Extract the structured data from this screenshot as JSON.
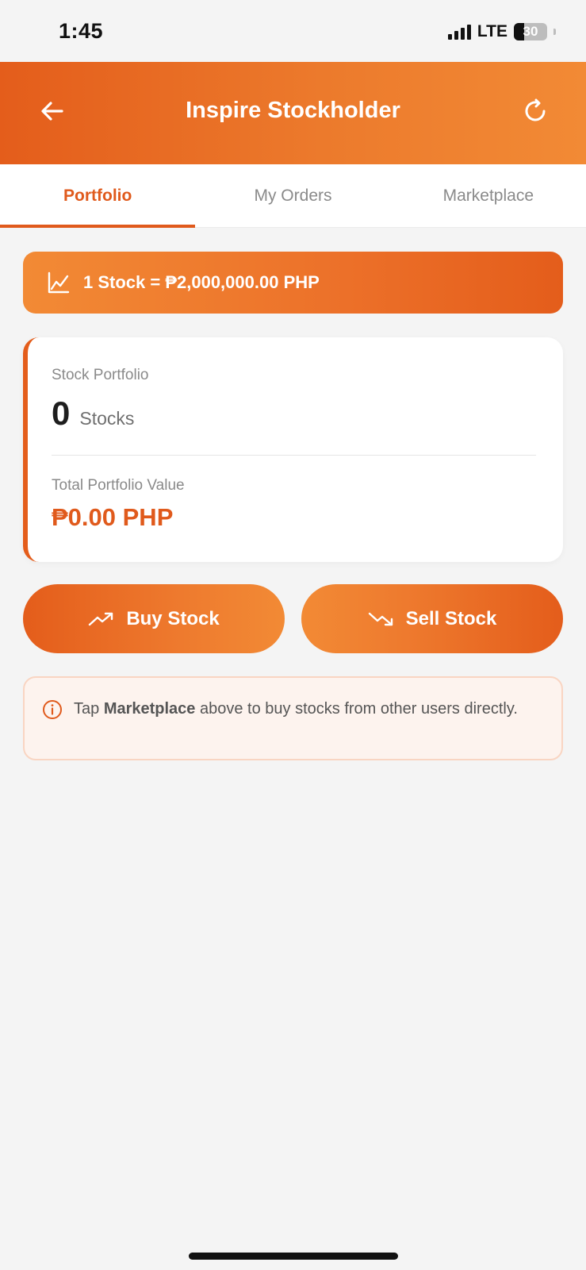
{
  "status_bar": {
    "time": "1:45",
    "network": "LTE",
    "battery": "30"
  },
  "header": {
    "title": "Inspire Stockholder",
    "back_icon": "arrow-left-icon",
    "refresh_icon": "refresh-icon"
  },
  "tabs": [
    {
      "label": "Portfolio",
      "active": true
    },
    {
      "label": "My Orders",
      "active": false
    },
    {
      "label": "Marketplace",
      "active": false
    }
  ],
  "price_banner": {
    "icon": "chart-line-icon",
    "text": "1 Stock = ₱2,000,000.00 PHP"
  },
  "portfolio": {
    "stock_label": "Stock Portfolio",
    "stock_count": "0",
    "stock_unit": "Stocks",
    "value_label": "Total Portfolio Value",
    "value": "₱0.00 PHP"
  },
  "actions": {
    "buy_label": "Buy Stock",
    "sell_label": "Sell Stock"
  },
  "info": {
    "prefix": "Tap ",
    "highlight": "Marketplace",
    "suffix": " above to buy stocks from other users directly."
  },
  "colors": {
    "accent": "#e05a1c",
    "gradient_light": "#f28a35",
    "info_bg": "#fdf3ee"
  }
}
